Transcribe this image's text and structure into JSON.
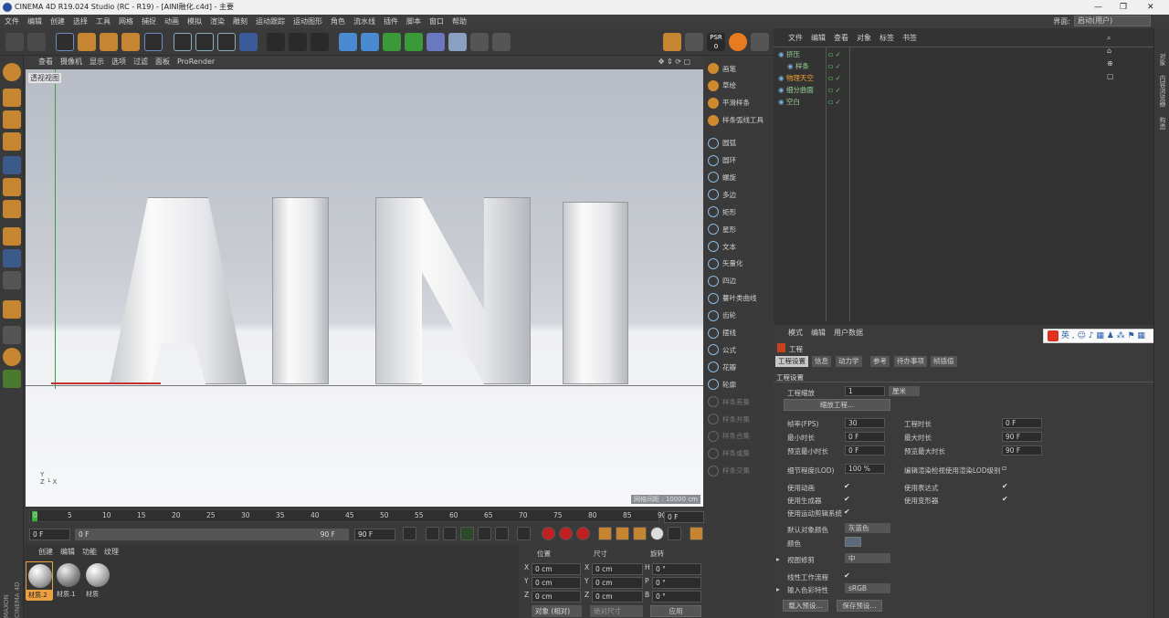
{
  "window": {
    "title": "CINEMA 4D R19.024 Studio (RC - R19) - [AINI融化.c4d] - 主要"
  },
  "menu": [
    "文件",
    "编辑",
    "创建",
    "选择",
    "工具",
    "网格",
    "捕捉",
    "动画",
    "模拟",
    "渲染",
    "雕刻",
    "运动跟踪",
    "运动图形",
    "角色",
    "流水线",
    "插件",
    "脚本",
    "窗口",
    "帮助"
  ],
  "layout": {
    "label": "界面:",
    "value": "启动(用户)"
  },
  "viewport": {
    "menu": [
      "查看",
      "摄像机",
      "显示",
      "选项",
      "过滤",
      "面板",
      "ProRender"
    ],
    "label": "透视视图",
    "distance": "网格间距 : 10000 cm",
    "scene_text": "AINI"
  },
  "object_toolbar": {
    "items": [
      {
        "label": "画笔",
        "icon": "pen-icon",
        "accent": true
      },
      {
        "label": "草绘",
        "icon": "sketch-icon",
        "accent": true
      },
      {
        "label": "平滑样条",
        "icon": "smooth-spline-icon",
        "accent": true
      },
      {
        "label": "样条弧线工具",
        "icon": "spline-arc-icon",
        "accent": true
      },
      {
        "label": "圆弧",
        "icon": "arc-icon"
      },
      {
        "label": "圆环",
        "icon": "circle-icon"
      },
      {
        "label": "螺旋",
        "icon": "helix-icon"
      },
      {
        "label": "多边",
        "icon": "polygon-icon"
      },
      {
        "label": "矩形",
        "icon": "rectangle-icon"
      },
      {
        "label": "星形",
        "icon": "star-icon"
      },
      {
        "label": "文本",
        "icon": "text-icon"
      },
      {
        "label": "矢量化",
        "icon": "vectorize-icon"
      },
      {
        "label": "四边",
        "icon": "four-side-icon"
      },
      {
        "label": "蔓叶类曲线",
        "icon": "cissoid-icon"
      },
      {
        "label": "齿轮",
        "icon": "cogwheel-icon"
      },
      {
        "label": "摆线",
        "icon": "cycloid-icon"
      },
      {
        "label": "公式",
        "icon": "formula-icon"
      },
      {
        "label": "花瓣",
        "icon": "flower-icon"
      },
      {
        "label": "轮廓",
        "icon": "profile-icon"
      },
      {
        "label": "样条差集",
        "icon": "spline-subtract-icon",
        "dim": true
      },
      {
        "label": "样条并集",
        "icon": "spline-union-icon",
        "dim": true
      },
      {
        "label": "样条合集",
        "icon": "spline-and-icon",
        "dim": true
      },
      {
        "label": "样条或集",
        "icon": "spline-or-icon",
        "dim": true
      },
      {
        "label": "样条交集",
        "icon": "spline-intersect-icon",
        "dim": true
      }
    ]
  },
  "timeline": {
    "ticks": [
      "0",
      "5",
      "10",
      "15",
      "20",
      "25",
      "30",
      "35",
      "40",
      "45",
      "50",
      "55",
      "60",
      "65",
      "70",
      "75",
      "80",
      "85",
      "90"
    ],
    "current": "0 F",
    "start": "0 F",
    "range_start": "0 F",
    "range_end": "90 F",
    "end": "90 F"
  },
  "materials": {
    "menu": [
      "创建",
      "编辑",
      "功能",
      "纹理"
    ],
    "items": [
      "材质.2",
      "材质.1",
      "材质"
    ]
  },
  "coordinates": {
    "headers": [
      "位置",
      "尺寸",
      "旋转"
    ],
    "rows": [
      {
        "axis": "X",
        "pos": "0 cm",
        "size": "0 cm",
        "rot_axis": "H",
        "rot": "0 °"
      },
      {
        "axis": "Y",
        "pos": "0 cm",
        "size": "0 cm",
        "rot_axis": "P",
        "rot": "0 °"
      },
      {
        "axis": "Z",
        "pos": "0 cm",
        "size": "0 cm",
        "rot_axis": "B",
        "rot": "0 °"
      }
    ],
    "mode": "对象 (相对)",
    "size_mode": "绝对尺寸",
    "apply": "应用"
  },
  "object_manager": {
    "menu": [
      "文件",
      "编辑",
      "查看",
      "对象",
      "标签",
      "书签"
    ],
    "objects": [
      {
        "name": "挤压",
        "indent": 0
      },
      {
        "name": "样条",
        "indent": 1
      },
      {
        "name": "物理天空",
        "indent": 0,
        "highlight": true
      },
      {
        "name": "细分曲面",
        "indent": 0
      },
      {
        "name": "空白",
        "indent": 0
      }
    ]
  },
  "attributes": {
    "menu": [
      "模式",
      "编辑",
      "用户数据"
    ],
    "title": "工程",
    "tabs": [
      "工程设置",
      "信息",
      "动力学",
      "参考",
      "待办事项",
      "帧插值"
    ],
    "section": "工程设置",
    "scale_label": "工程缩放",
    "scale_value": "1",
    "scale_unit": "厘米",
    "scale_button": "缩放工程...",
    "fps_label": "帧率(FPS)",
    "fps": "30",
    "duration_label": "工程时长",
    "duration": "0 F",
    "min_label": "最小时长",
    "min": "0 F",
    "max_label": "最大时长",
    "max": "90 F",
    "pmin_label": "预览最小时长",
    "pmin": "0 F",
    "pmax_label": "预览最大时长",
    "pmax": "90 F",
    "lod_label": "细节程度(LOD)",
    "lod": "100 %",
    "lod_render_label": "编辑渲染检视使用渲染LOD级别",
    "use_anim": "使用动画",
    "use_expr": "使用表达式",
    "use_gen": "使用生成器",
    "use_deform": "使用变形器",
    "use_mograph": "使用运动剪辑系统",
    "default_color_label": "默认对象颜色",
    "default_color": "灰蓝色",
    "color_label": "颜色",
    "view_clip_label": "视图修剪",
    "view_clip": "中",
    "linear_label": "线性工作流程",
    "input_color_label": "输入色彩特性",
    "input_color": "sRGB",
    "load_preset": "载入预设...",
    "save_preset": "保存预设..."
  },
  "ime": {
    "mode": "英"
  },
  "right_tabs": [
    "对象",
    "内容浏览器",
    "构造"
  ],
  "brand": {
    "line1": "MAXON",
    "line2": "CINEMA 4D"
  },
  "colors": {
    "accent": "#c68530",
    "selection": "#e8a040",
    "highlight_text": "#f0a030"
  }
}
